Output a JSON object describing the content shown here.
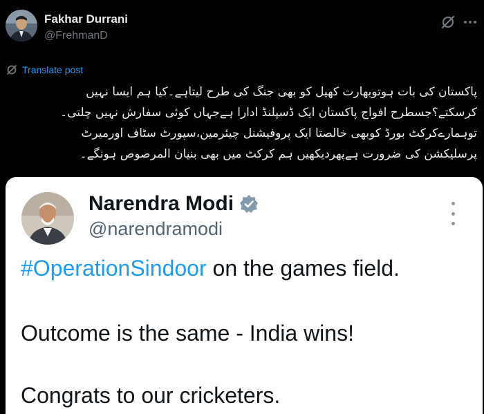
{
  "post": {
    "author_name": "Fakhar Durrani",
    "author_handle": "@FrehmanD",
    "translate_label": "Translate post",
    "urdu_lines": [
      "پاکستان کی بات ہوتوبھارت کھیل کو بھی جنگ کی طرح لیتاہے۔کیا ہم ایسا نہیں",
      "کرسکتے؟جسطرح افواج پاکستان ایک ڈسپلنڈ ادارا ہےجہاں کوئی سفارش نہیں چلتی۔",
      "توہمارےکرکٹ بورڈ کوبھی خالصتا ایک پروفیشنل چیئرمین،سپورٹ سٹاف اورمیرٹ",
      "پرسلیکشن کی ضرورت ہےپھردیکھیں ہم کرکٹ میں بھی بنیان المرصوص ہونگے۔"
    ],
    "icons": {
      "grok": "grok-icon",
      "more": "more-horizontal-icon",
      "translate": "translate-icon"
    }
  },
  "quoted": {
    "author_name": "Narendra Modi",
    "author_handle": "@narendramodi",
    "verified": true,
    "hashtag": "#OperationSindoor",
    "line1_rest": " on the games field.",
    "line2": "Outcome is the same - India wins!",
    "line3": "Congrats to our cricketers.",
    "icons": {
      "verified": "verified-badge-icon",
      "more": "more-vertical-icon"
    }
  },
  "colors": {
    "background": "#000000",
    "card_background": "#ffffff",
    "link_blue": "#1d9bf0",
    "muted_gray": "#71767b",
    "text_light": "#e7e9ea",
    "text_dark": "#0f1419"
  }
}
